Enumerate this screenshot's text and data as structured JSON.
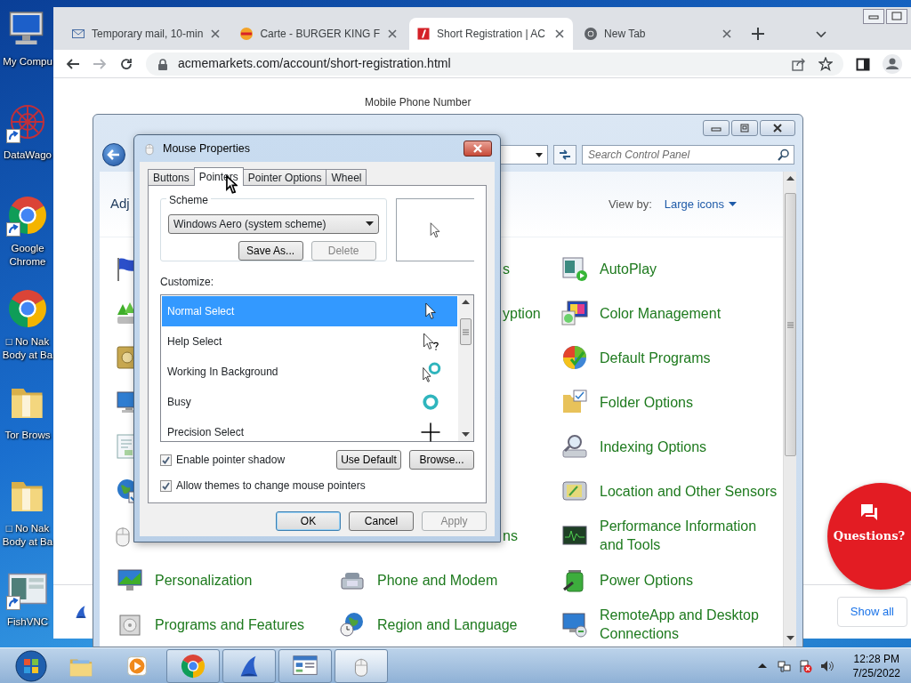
{
  "desktop_icons": [
    {
      "kind": "computer",
      "shortcut": false,
      "label": "My Compu"
    },
    {
      "kind": "network",
      "shortcut": true,
      "label": "DataWago"
    },
    {
      "kind": "chrome",
      "shortcut": true,
      "label": "Google\nChrome"
    },
    {
      "kind": "chrome",
      "shortcut": false,
      "label": "□ No Nak\nBody at Ba"
    },
    {
      "kind": "folder",
      "shortcut": false,
      "label": "Tor Brows"
    },
    {
      "kind": "folder",
      "shortcut": false,
      "label": "□ No Nak\nBody at Ba"
    },
    {
      "kind": "vnc",
      "shortcut": true,
      "label": "FishVNC"
    }
  ],
  "browser": {
    "tabs": [
      {
        "kind": "envelope",
        "title": "Temporary mail, 10-min",
        "selected": false
      },
      {
        "kind": "burger",
        "title": "Carte - BURGER KING F",
        "selected": false
      },
      {
        "kind": "logo",
        "title": "Short Registration | AC",
        "selected": true
      },
      {
        "kind": "chrome-gray",
        "title": "New Tab",
        "selected": false
      }
    ],
    "url": "acmemarkets.com/account/short-registration.html",
    "page": {
      "field_label": "Mobile Phone Number",
      "chat_label": "Questions?",
      "show_all": "Show all"
    }
  },
  "control_panel": {
    "search_placeholder": "Search Control Panel",
    "heading": "Adj",
    "view_by_label": "View by:",
    "view_by_value": "Large icons",
    "columns": [
      [
        {
          "kind": "flag"
        },
        {
          "kind": "arrows"
        },
        {
          "kind": "safe"
        },
        {
          "kind": "monitor"
        },
        {
          "kind": "certificate"
        },
        {
          "kind": "globe"
        },
        {
          "kind": "mouse"
        },
        {
          "kind": "display",
          "text": "Personalization"
        },
        {
          "kind": "programs",
          "text": "Programs and Features"
        }
      ],
      [
        {
          "kind": "fragment",
          "text": "s"
        },
        {
          "kind": "fragment",
          "text": "yption"
        },
        {
          "kind": "hidden"
        },
        {
          "kind": "hidden"
        },
        {
          "kind": "hidden"
        },
        {
          "kind": "hidden"
        },
        {
          "kind": "fragment",
          "text": "ns"
        },
        {
          "kind": "phone",
          "text": "Phone and Modem"
        },
        {
          "kind": "globe-clock",
          "text": "Region and Language"
        }
      ],
      [
        {
          "kind": "autoplay",
          "text": "AutoPlay"
        },
        {
          "kind": "color",
          "text": "Color Management"
        },
        {
          "kind": "orb",
          "text": "Default Programs"
        },
        {
          "kind": "folder-options",
          "text": "Folder Options"
        },
        {
          "kind": "magnifier",
          "text": "Indexing Options"
        },
        {
          "kind": "device",
          "text": "Location and Other Sensors"
        },
        {
          "kind": "chart",
          "text": "Performance Information and Tools"
        },
        {
          "kind": "battery",
          "text": "Power Options"
        },
        {
          "kind": "remote",
          "text": "RemoteApp and Desktop Connections"
        }
      ]
    ]
  },
  "dialog": {
    "title": "Mouse Properties",
    "tabs": [
      {
        "label": "Buttons",
        "selected": false
      },
      {
        "label": "Pointers",
        "selected": true
      },
      {
        "label": "Pointer Options",
        "selected": false
      },
      {
        "label": "Wheel",
        "selected": false
      }
    ],
    "scheme_label": "Scheme",
    "scheme_value": "Windows Aero (system scheme)",
    "scheme_buttons": [
      {
        "label": "Save As...",
        "disabled": false
      },
      {
        "label": "Delete",
        "disabled": true
      }
    ],
    "customize_label": "Customize:",
    "pointers": [
      {
        "label": "Normal Select",
        "kind": "arrow",
        "selected": true
      },
      {
        "label": "Help Select",
        "kind": "help",
        "selected": false
      },
      {
        "label": "Working In Background",
        "kind": "working",
        "selected": false
      },
      {
        "label": "Busy",
        "kind": "busy",
        "selected": false
      },
      {
        "label": "Precision Select",
        "kind": "precision",
        "selected": false
      }
    ],
    "options": [
      {
        "label": "Enable pointer shadow",
        "checked": true
      },
      {
        "label": "Allow themes to change mouse pointers",
        "checked": true
      }
    ],
    "list_buttons": [
      {
        "label": "Use Default",
        "disabled": false
      },
      {
        "label": "Browse...",
        "disabled": false
      }
    ],
    "footer_buttons": [
      {
        "label": "OK",
        "disabled": false,
        "default": true
      },
      {
        "label": "Cancel",
        "disabled": false,
        "default": false
      },
      {
        "label": "Apply",
        "disabled": true,
        "default": false
      }
    ]
  },
  "taskbar": {
    "apps": [
      {
        "kind": "explorer",
        "running": false,
        "selected": false
      },
      {
        "kind": "media",
        "running": false,
        "selected": false
      },
      {
        "kind": "chrome",
        "running": true,
        "selected": false
      },
      {
        "kind": "shark",
        "running": true,
        "selected": false
      },
      {
        "kind": "control",
        "running": true,
        "selected": false
      },
      {
        "kind": "mouse",
        "running": true,
        "selected": true
      }
    ],
    "time": "12:28 PM",
    "date": "7/25/2022"
  }
}
